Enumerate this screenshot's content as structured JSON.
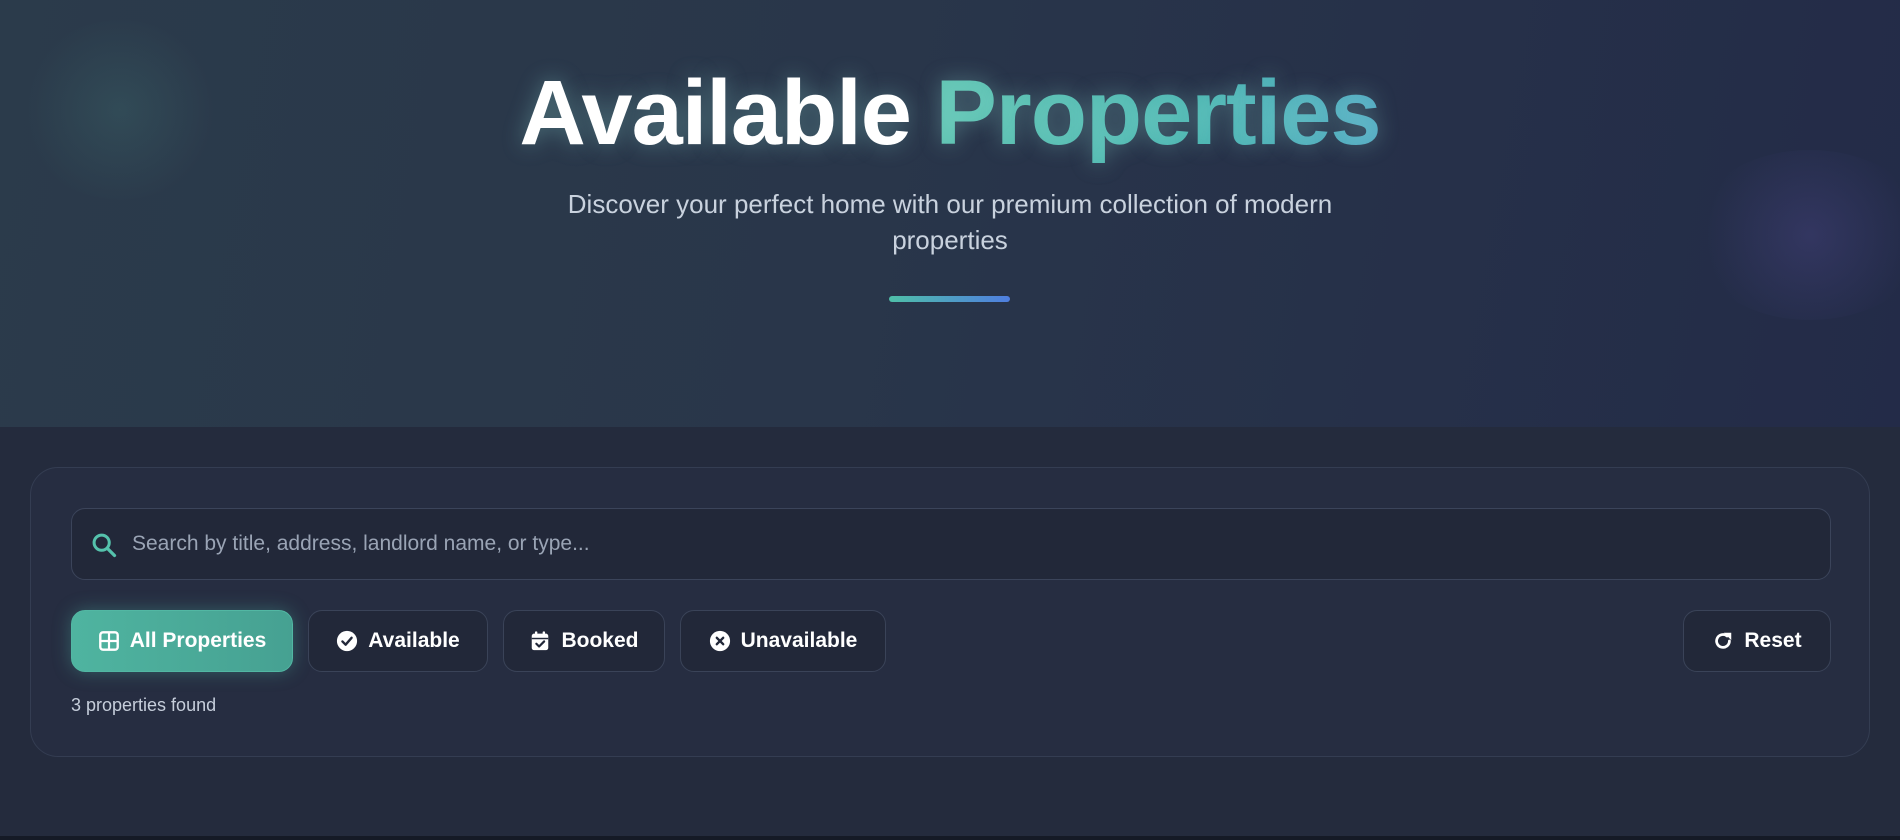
{
  "hero": {
    "title_main": "Available",
    "title_accent": "Properties",
    "subtitle": "Discover your perfect home with our premium collection of modern properties"
  },
  "search": {
    "placeholder": "Search by title, address, landlord name, or type...",
    "value": ""
  },
  "filters": [
    {
      "label": "All Properties",
      "icon": "grid-icon",
      "active": true
    },
    {
      "label": "Available",
      "icon": "check-circle-icon",
      "active": false
    },
    {
      "label": "Booked",
      "icon": "calendar-check-icon",
      "active": false
    },
    {
      "label": "Unavailable",
      "icon": "x-circle-icon",
      "active": false
    }
  ],
  "reset": {
    "label": "Reset",
    "icon": "refresh-icon"
  },
  "results": {
    "count_text": "3 properties found"
  },
  "colors": {
    "accent": "#4fb4a0",
    "background": "#242b3d",
    "hero_start": "#2b3b4b",
    "hero_end": "#232b48"
  }
}
